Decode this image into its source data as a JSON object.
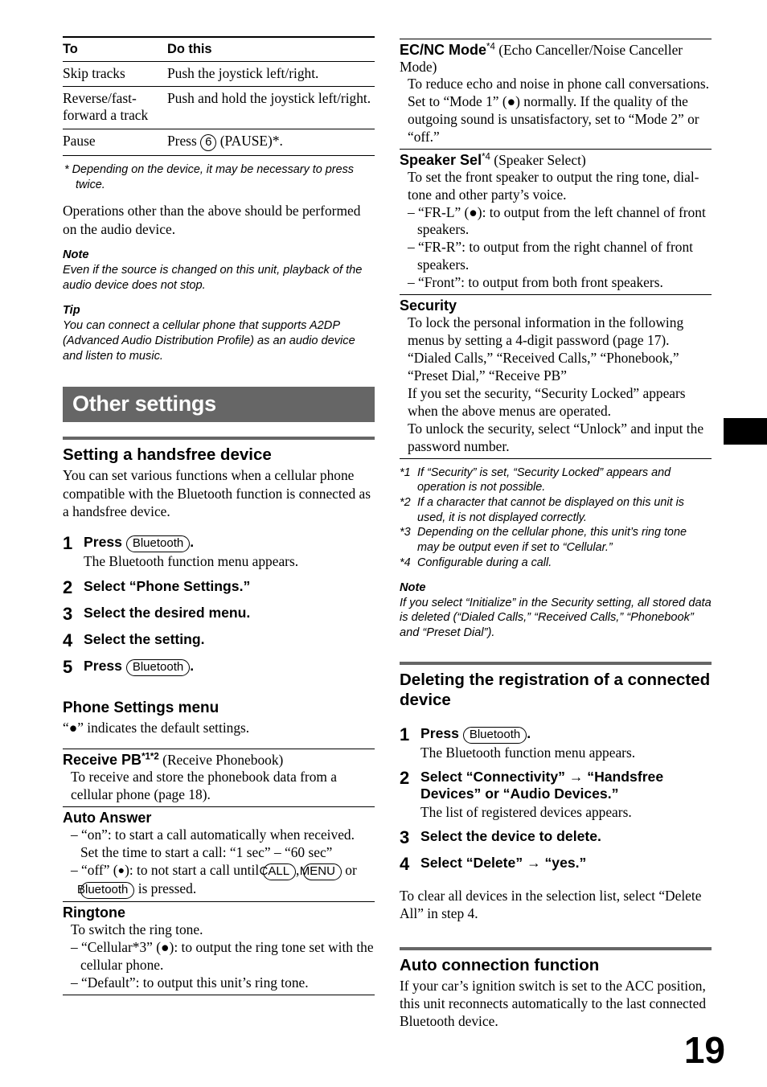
{
  "page": {
    "number": "19",
    "thumb_tab": true,
    "banner_color": "#666666"
  },
  "left_column": {
    "ops_table": {
      "headers": [
        "To",
        "Do this"
      ],
      "rows": [
        {
          "to": "Skip tracks",
          "do": "Push the joystick left/right."
        },
        {
          "to": "Reverse/fast-forward a track",
          "do": "Push and hold the joystick left/right."
        },
        {
          "to": "Pause",
          "do_prefix": "Press ",
          "do_key": "6",
          "do_suffix": " (PAUSE)*."
        }
      ]
    },
    "table_footnote": "* Depending on the device, it may be necessary to press twice.",
    "after_table_text": "Operations other than the above should be performed on the audio device.",
    "note": {
      "heading": "Note",
      "text": "Even if the source is changed on this unit, playback of the audio device does not stop."
    },
    "tip": {
      "heading": "Tip",
      "text": "You can connect a cellular phone that supports A2DP (Advanced Audio Distribution Profile) as an audio device and listen to music."
    },
    "banner_title": "Other settings",
    "handsfree": {
      "heading": "Setting a handsfree device",
      "intro": "You can set various functions when a cellular phone compatible with the Bluetooth function is connected as a handsfree device.",
      "steps": [
        {
          "num": "1",
          "lead_prefix": "Press ",
          "lead_key": "Bluetooth",
          "lead_suffix": ".",
          "sub": "The Bluetooth function menu appears."
        },
        {
          "num": "2",
          "lead_prefix": "Select “Phone Settings.”",
          "lead_key": "",
          "lead_suffix": "",
          "sub": ""
        },
        {
          "num": "3",
          "lead_prefix": "Select the desired menu.",
          "lead_key": "",
          "lead_suffix": "",
          "sub": ""
        },
        {
          "num": "4",
          "lead_prefix": "Select the setting.",
          "lead_key": "",
          "lead_suffix": "",
          "sub": ""
        },
        {
          "num": "5",
          "lead_prefix": "Press ",
          "lead_key": "Bluetooth",
          "lead_suffix": ".",
          "sub": ""
        }
      ]
    },
    "phone_settings": {
      "heading": "Phone Settings menu",
      "default_note": "“●” indicates the default settings.",
      "entries": [
        {
          "label": "Receive PB",
          "sup": "*1*2",
          "paren": " (Receive Phonebook)",
          "lines": [
            "To receive and store the phonebook data from a cellular phone (page 18)."
          ]
        },
        {
          "label": "Auto Answer",
          "sup": "",
          "paren": "",
          "lines": [
            "– “on”: to start a call automatically when received. Set the time to start a call: “1 sec” – “60 sec”",
            "– “off” (●): to not start a call until [CALL], [MENU] or [Bluetooth] is pressed."
          ]
        },
        {
          "label": "Ringtone",
          "sup": "",
          "paren": "",
          "lines": [
            "To switch the ring tone.",
            "– “Cellular*3” (●): to output the ring tone set with the cellular phone.",
            "– “Default”: to output this unit’s ring tone."
          ]
        }
      ],
      "keys": {
        "call": "CALL",
        "menu": "MENU",
        "bluetooth": "Bluetooth"
      }
    }
  },
  "right_column": {
    "entries": [
      {
        "label": "EC/NC Mode",
        "sup": "*4",
        "paren": " (Echo Canceller/Noise Canceller Mode)",
        "lines": [
          "To reduce echo and noise in phone call conversations.",
          "Set to “Mode 1” (●) normally. If the quality of the outgoing sound is unsatisfactory, set to “Mode 2” or “off.”"
        ]
      },
      {
        "label": "Speaker Sel",
        "sup": "*4",
        "paren": " (Speaker Select)",
        "lines": [
          "To set the front speaker to output the ring tone, dial-tone and other party’s voice.",
          "– “FR-L” (●): to output from the left channel of front speakers.",
          "– “FR-R”: to output from the right channel of front speakers.",
          "– “Front”: to output from both front speakers."
        ]
      },
      {
        "label": "Security",
        "sup": "",
        "paren": "",
        "lines": [
          "To lock the personal information in the following menus by setting a 4-digit password (page 17).",
          "“Dialed Calls,” “Received Calls,” “Phonebook,” “Preset Dial,” “Receive PB”",
          "If you set the security, “Security Locked” appears when the above menus are operated.",
          "To unlock the security, select “Unlock” and input the password number."
        ]
      }
    ],
    "footnotes": [
      {
        "mark": "*1",
        "text": "If “Security” is set, “Security Locked” appears and operation is not possible."
      },
      {
        "mark": "*2",
        "text": "If a character that cannot be displayed on this unit is used, it is not displayed correctly."
      },
      {
        "mark": "*3",
        "text": "Depending on the cellular phone, this unit’s ring tone may be output even if set to “Cellular.”"
      },
      {
        "mark": "*4",
        "text": "Configurable during a call."
      }
    ],
    "note": {
      "heading": "Note",
      "text": "If you select “Initialize” in the Security setting, all stored data is deleted (“Dialed Calls,” “Received Calls,” “Phonebook” and “Preset Dial”)."
    },
    "deleting": {
      "heading": "Deleting the registration of a connected device",
      "steps": [
        {
          "num": "1",
          "lead_prefix": "Press ",
          "lead_key": "Bluetooth",
          "lead_suffix": ".",
          "sub": "The Bluetooth function menu appears."
        },
        {
          "num": "2",
          "lead_prefix": "Select “Connectivity” → “Handsfree Devices” or “Audio Devices.”",
          "lead_key": "",
          "lead_suffix": "",
          "sub": "The list of registered devices appears."
        },
        {
          "num": "3",
          "lead_prefix": "Select the device to delete.",
          "lead_key": "",
          "lead_suffix": "",
          "sub": ""
        },
        {
          "num": "4",
          "lead_prefix": "Select “Delete” → “yes.”",
          "lead_key": "",
          "lead_suffix": "",
          "sub": ""
        }
      ],
      "after_text": "To clear all devices in the selection list, select “Delete All” in step 4."
    },
    "auto_connection": {
      "heading": "Auto connection function",
      "text": "If your car’s ignition switch is set to the ACC position, this unit reconnects automatically to the last connected Bluetooth device."
    }
  }
}
